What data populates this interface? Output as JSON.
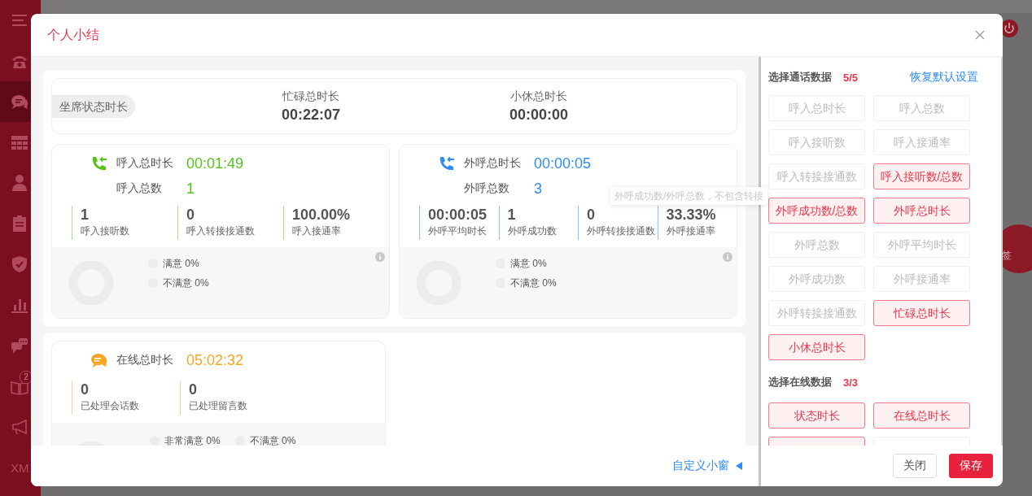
{
  "sidebar": {
    "items": [
      {
        "kind": "menu",
        "selected": false
      },
      {
        "kind": "phone",
        "selected": false
      },
      {
        "kind": "chat",
        "selected": true
      },
      {
        "kind": "grid",
        "selected": false
      },
      {
        "kind": "person",
        "selected": false
      },
      {
        "kind": "clipboard",
        "selected": false
      },
      {
        "kind": "shield",
        "selected": false
      },
      {
        "kind": "chart",
        "selected": false
      },
      {
        "kind": "chats",
        "selected": false
      },
      {
        "kind": "book",
        "selected": false,
        "badge": "2"
      },
      {
        "kind": "megaphone",
        "selected": false
      },
      {
        "kind": "text",
        "selected": false,
        "label": "XM"
      }
    ]
  },
  "background": {
    "sign_button": "签"
  },
  "dialog": {
    "title": "个人小结"
  },
  "status_card": {
    "label": "坐席状态时长",
    "metrics": [
      {
        "label": "忙碌总时长",
        "value": "00:22:07"
      },
      {
        "label": "小休总时长",
        "value": "00:00:00"
      }
    ]
  },
  "call_cards": [
    {
      "kind": "inbound",
      "color": "#52c41a",
      "title": "呼入总时长",
      "value": "00:01:49",
      "count_label": "呼入总数",
      "count": "1",
      "stats": [
        {
          "value": "1",
          "label": "呼入接听数"
        },
        {
          "value": "0",
          "label": "呼入转接接通数"
        },
        {
          "value": "100.00%",
          "label": "呼入接通率"
        }
      ],
      "satisfaction": [
        "满意 0%",
        "不满意 0%"
      ]
    },
    {
      "kind": "outbound",
      "color": "#2f8cf0",
      "title": "外呼总时长",
      "value": "00:00:05",
      "count_label": "外呼总数",
      "count": "3",
      "stats": [
        {
          "value": "00:00:05",
          "label": "外呼平均时长"
        },
        {
          "value": "1",
          "label": "外呼成功数"
        },
        {
          "value": "0",
          "label": "外呼转接接通数"
        },
        {
          "value": "33.33%",
          "label": "外呼接通率"
        }
      ],
      "satisfaction": [
        "满意 0%",
        "不满意 0%"
      ]
    }
  ],
  "online_card": {
    "color": "#f5a623",
    "title": "在线总时长",
    "value": "05:02:32",
    "stats": [
      {
        "value": "0",
        "label": "已处理会话数"
      },
      {
        "value": "0",
        "label": "已处理留言数"
      }
    ],
    "satisfaction": [
      "非常满意 0%",
      "不满意 0%"
    ]
  },
  "tooltip": "外呼成功数/外呼总数，不包含转接",
  "footer_link": "自定义小窗",
  "panel": {
    "sections": [
      {
        "title": "选择通话数据",
        "count": "5/5",
        "reset": "恢复默认设置",
        "options": [
          {
            "label": "呼入总时长",
            "selected": false
          },
          {
            "label": "呼入总数",
            "selected": false
          },
          {
            "label": "呼入接听数",
            "selected": false
          },
          {
            "label": "呼入接通率",
            "selected": false
          },
          {
            "label": "呼入转接接通数",
            "selected": false
          },
          {
            "label": "呼入接听数/总数",
            "selected": true
          },
          {
            "label": "外呼成功数/总数",
            "selected": true
          },
          {
            "label": "外呼总时长",
            "selected": true
          },
          {
            "label": "外呼总数",
            "selected": false
          },
          {
            "label": "外呼平均时长",
            "selected": false
          },
          {
            "label": "外呼成功数",
            "selected": false
          },
          {
            "label": "外呼接通率",
            "selected": false
          },
          {
            "label": "外呼转接接通数",
            "selected": false
          },
          {
            "label": "忙碌总时长",
            "selected": true
          },
          {
            "label": "小休总时长",
            "selected": true
          }
        ]
      },
      {
        "title": "选择在线数据",
        "count": "3/3",
        "options": [
          {
            "label": "状态时长",
            "selected": true
          },
          {
            "label": "在线总时长",
            "selected": true
          },
          {
            "selected": true
          },
          {
            "selected": false
          }
        ]
      }
    ]
  },
  "buttons": [
    {
      "label": "关闭",
      "kind": "default"
    },
    {
      "label": "保存",
      "kind": "primary"
    }
  ]
}
